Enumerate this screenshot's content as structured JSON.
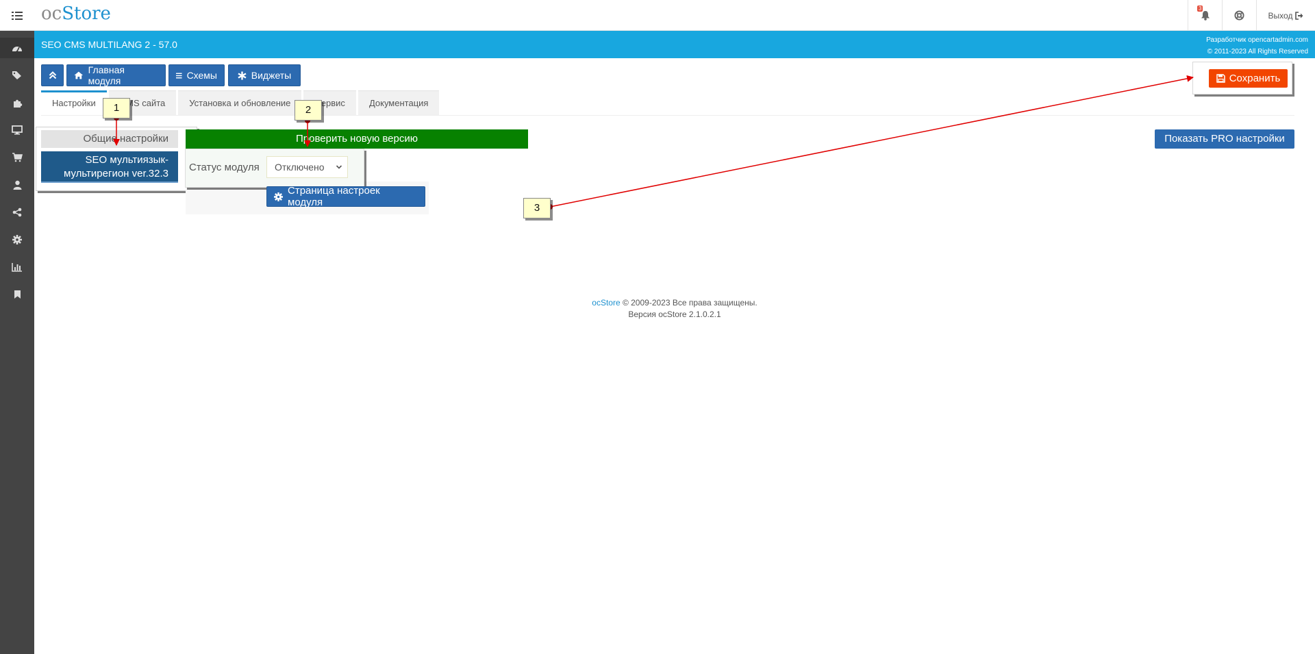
{
  "topbar": {
    "logo_oc": "oc",
    "logo_store": "Store",
    "notification_count": "3",
    "logout_label": "Выход"
  },
  "sidebar": {
    "icons": [
      "dashboard-icon",
      "tags-icon",
      "puzzle-icon",
      "desktop-icon",
      "cart-icon",
      "user-icon",
      "share-icon",
      "cog-icon",
      "bar-chart-icon",
      "bookmark-icon"
    ]
  },
  "header": {
    "title": "SEO CMS MULTILANG 2 - 57.0",
    "developer": "Разработчик opencartadmin.com",
    "copyright": "© 2011-2023 All Rights Reserved"
  },
  "toolbar": {
    "main_label": "Главная модуля",
    "schemes_label": "Схемы",
    "widgets_label": "Виджеты",
    "save_label": "Сохранить"
  },
  "tabs": [
    {
      "label": "Настройки"
    },
    {
      "label": "CMS сайта"
    },
    {
      "label": "Установка и обновление"
    },
    {
      "label": "Сервис"
    },
    {
      "label": "Документация"
    }
  ],
  "left_nav": {
    "general": "Общие настройки",
    "seo": "SEO мультиязык-мультирегион ver.32.3"
  },
  "main": {
    "check_version": "Проверить новую версию",
    "show_pro": "Показать PRO настройки",
    "status_label": "Статус модуля",
    "status_value": "Отключено",
    "settings_page": "Страница настроек модуля"
  },
  "annotations": [
    "1",
    "2",
    "3"
  ],
  "footer": {
    "brand": "ocStore",
    "rights": " © 2009-2023 Все права защищены.",
    "version": "Версия ocStore 2.1.0.2.1"
  },
  "colors": {
    "header_band": "#18a7df",
    "primary_button": "#2c6ab0",
    "save_button": "#f24500",
    "check_button": "#078100",
    "annotation_arrow": "#e00000"
  }
}
